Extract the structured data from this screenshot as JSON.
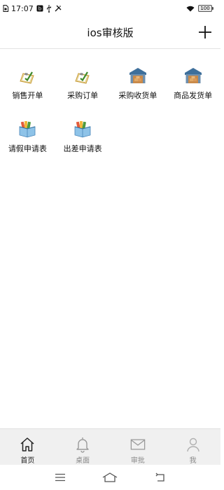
{
  "status_bar": {
    "time": "17:07",
    "battery": "100"
  },
  "nav": {
    "title": "ios审核版"
  },
  "grid": {
    "items": [
      {
        "label": "销售开单",
        "icon": "clipboard-check-icon"
      },
      {
        "label": "采购订单",
        "icon": "clipboard-check-icon"
      },
      {
        "label": "采购收货单",
        "icon": "warehouse-icon"
      },
      {
        "label": "商品发货单",
        "icon": "warehouse-icon"
      },
      {
        "label": "请假申请表",
        "icon": "box-books-icon"
      },
      {
        "label": "出差申请表",
        "icon": "box-books-icon"
      }
    ]
  },
  "tab_bar": {
    "tabs": [
      {
        "label": "首页",
        "icon": "home-icon",
        "active": true
      },
      {
        "label": "桌面",
        "icon": "bell-icon",
        "active": false
      },
      {
        "label": "审批",
        "icon": "mail-icon",
        "active": false
      },
      {
        "label": "我",
        "icon": "user-icon",
        "active": false
      }
    ]
  },
  "colors": {
    "tab_bar_bg": "#f0f0f0",
    "active_tab": "#222222",
    "inactive_tab": "#8a8a8a",
    "divider": "#e3e3e3"
  }
}
